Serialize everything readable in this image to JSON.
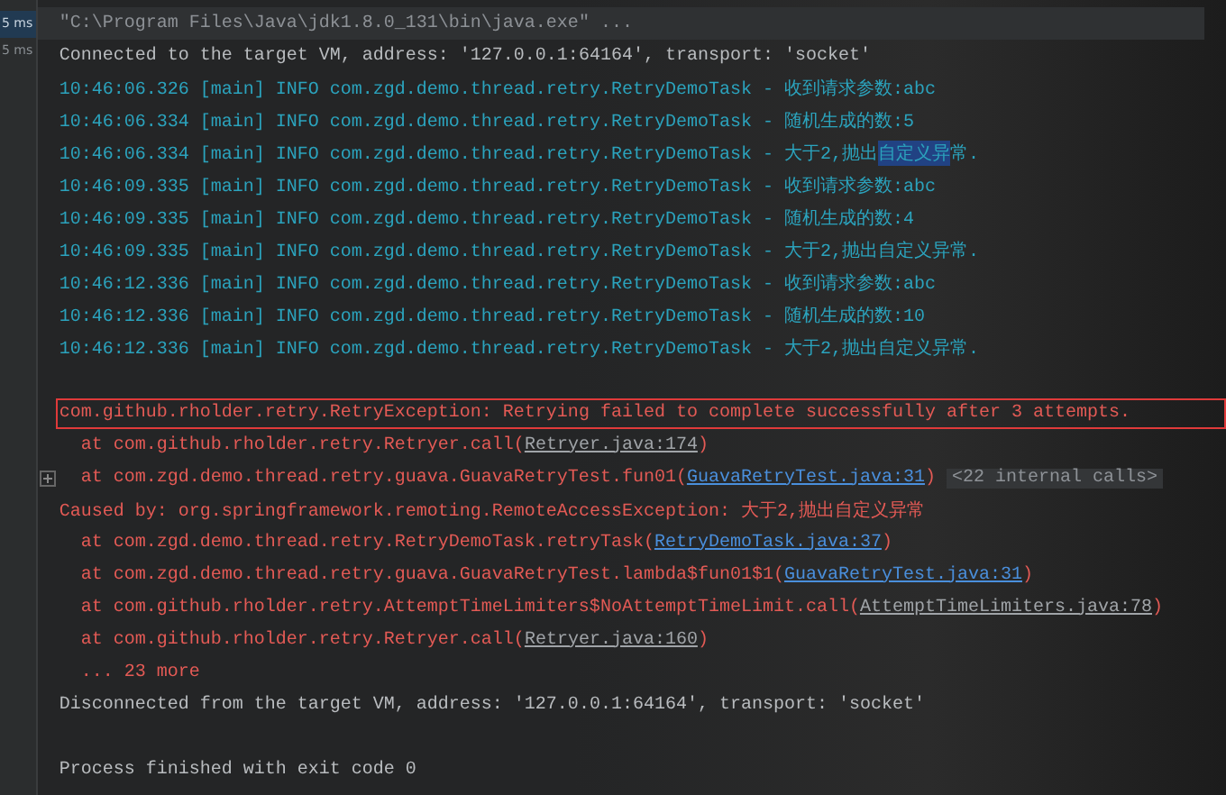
{
  "gutter": {
    "items": [
      {
        "label": "5 ms",
        "selected": true
      },
      {
        "label": "5 ms",
        "selected": false
      }
    ]
  },
  "console": {
    "lines": [
      {
        "kind": "command",
        "segments": [
          {
            "kind": "plain",
            "text": "\"C:\\Program Files\\Java\\jdk1.8.0_131\\bin\\java.exe\" ..."
          }
        ]
      },
      {
        "kind": "system",
        "segments": [
          {
            "kind": "plain",
            "text": "Connected to the target VM, address: '127.0.0.1:64164', transport: 'socket'"
          }
        ]
      },
      {
        "kind": "log",
        "segments": [
          {
            "kind": "plain",
            "text": "10:46:06.326 [main] INFO com.zgd.demo.thread.retry.RetryDemoTask - 收到请求参数:abc"
          }
        ]
      },
      {
        "kind": "log",
        "segments": [
          {
            "kind": "plain",
            "text": "10:46:06.334 [main] INFO com.zgd.demo.thread.retry.RetryDemoTask - 随机生成的数:5"
          }
        ]
      },
      {
        "kind": "log",
        "segments": [
          {
            "kind": "plain",
            "text": "10:46:06.334 [main] INFO com.zgd.demo.thread.retry.RetryDemoTask - 大于2,抛出"
          },
          {
            "kind": "selection",
            "text": "自定义异"
          },
          {
            "kind": "plain",
            "text": "常."
          }
        ]
      },
      {
        "kind": "log",
        "segments": [
          {
            "kind": "plain",
            "text": "10:46:09.335 [main] INFO com.zgd.demo.thread.retry.RetryDemoTask - 收到请求参数:abc"
          }
        ]
      },
      {
        "kind": "log",
        "segments": [
          {
            "kind": "plain",
            "text": "10:46:09.335 [main] INFO com.zgd.demo.thread.retry.RetryDemoTask - 随机生成的数:4"
          }
        ]
      },
      {
        "kind": "log",
        "segments": [
          {
            "kind": "plain",
            "text": "10:46:09.335 [main] INFO com.zgd.demo.thread.retry.RetryDemoTask - 大于2,抛出自定义异常."
          }
        ]
      },
      {
        "kind": "log",
        "segments": [
          {
            "kind": "plain",
            "text": "10:46:12.336 [main] INFO com.zgd.demo.thread.retry.RetryDemoTask - 收到请求参数:abc"
          }
        ]
      },
      {
        "kind": "log",
        "segments": [
          {
            "kind": "plain",
            "text": "10:46:12.336 [main] INFO com.zgd.demo.thread.retry.RetryDemoTask - 随机生成的数:10"
          }
        ]
      },
      {
        "kind": "log",
        "segments": [
          {
            "kind": "plain",
            "text": "10:46:12.336 [main] INFO com.zgd.demo.thread.retry.RetryDemoTask - 大于2,抛出自定义异常."
          }
        ]
      },
      {
        "kind": "spacer"
      },
      {
        "kind": "error",
        "highlighted": true,
        "segments": [
          {
            "kind": "plain",
            "text": "com.github.rholder.retry.RetryException: Retrying failed to complete successfully after 3 attempts."
          }
        ]
      },
      {
        "kind": "frame",
        "segments": [
          {
            "kind": "plain",
            "text": "at com.github.rholder.retry.Retryer.call("
          },
          {
            "kind": "library-link",
            "text": "Retryer.java:174"
          },
          {
            "kind": "plain",
            "text": ")"
          }
        ]
      },
      {
        "kind": "frame",
        "foldable": true,
        "segments": [
          {
            "kind": "plain",
            "text": "at com.zgd.demo.thread.retry.guava.GuavaRetryTest.fun01("
          },
          {
            "kind": "link",
            "text": "GuavaRetryTest.java:31"
          },
          {
            "kind": "plain",
            "text": ")"
          },
          {
            "kind": "note",
            "text": "<22 internal calls>"
          }
        ]
      },
      {
        "kind": "error",
        "segments": [
          {
            "kind": "plain",
            "text": "Caused by: org.springframework.remoting.RemoteAccessException: 大于2,抛出自定义异常"
          }
        ]
      },
      {
        "kind": "frame",
        "segments": [
          {
            "kind": "plain",
            "text": "at com.zgd.demo.thread.retry.RetryDemoTask.retryTask("
          },
          {
            "kind": "link",
            "text": "RetryDemoTask.java:37"
          },
          {
            "kind": "plain",
            "text": ")"
          }
        ]
      },
      {
        "kind": "frame",
        "segments": [
          {
            "kind": "plain",
            "text": "at com.zgd.demo.thread.retry.guava.GuavaRetryTest.lambda$fun01$1("
          },
          {
            "kind": "link",
            "text": "GuavaRetryTest.java:31"
          },
          {
            "kind": "plain",
            "text": ")"
          }
        ]
      },
      {
        "kind": "frame",
        "segments": [
          {
            "kind": "plain",
            "text": "at com.github.rholder.retry.AttemptTimeLimiters$NoAttemptTimeLimit.call("
          },
          {
            "kind": "library-link",
            "text": "AttemptTimeLimiters.java:78"
          },
          {
            "kind": "plain",
            "text": ")"
          }
        ]
      },
      {
        "kind": "frame",
        "segments": [
          {
            "kind": "plain",
            "text": "at com.github.rholder.retry.Retryer.call("
          },
          {
            "kind": "library-link",
            "text": "Retryer.java:160"
          },
          {
            "kind": "plain",
            "text": ")"
          }
        ]
      },
      {
        "kind": "frame",
        "segments": [
          {
            "kind": "plain",
            "text": "... 23 more"
          }
        ]
      },
      {
        "kind": "system",
        "segments": [
          {
            "kind": "plain",
            "text": "Disconnected from the target VM, address: '127.0.0.1:64164', transport: 'socket'"
          }
        ]
      },
      {
        "kind": "spacer"
      },
      {
        "kind": "system",
        "segments": [
          {
            "kind": "plain",
            "text": "Process finished with exit code 0"
          }
        ]
      }
    ]
  }
}
